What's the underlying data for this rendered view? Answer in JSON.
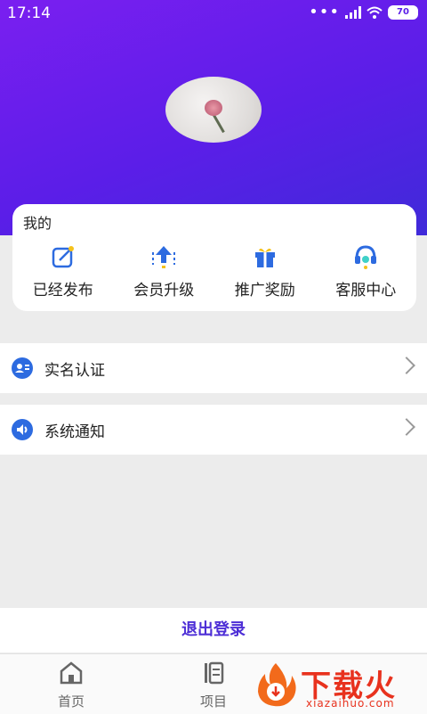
{
  "status": {
    "time": "17:14",
    "battery": "70",
    "signal": "HD"
  },
  "card": {
    "title": "我的",
    "items": [
      {
        "label": "已经发布",
        "icon": "edit-icon"
      },
      {
        "label": "会员升级",
        "icon": "upgrade-icon"
      },
      {
        "label": "推广奖励",
        "icon": "gift-icon"
      },
      {
        "label": "客服中心",
        "icon": "headset-icon"
      }
    ]
  },
  "menu": [
    {
      "label": "实名认证",
      "icon": "id-card-icon"
    },
    {
      "label": "系统通知",
      "icon": "speaker-icon"
    }
  ],
  "logout_label": "退出登录",
  "tabs": [
    {
      "label": "首页",
      "icon": "home-icon"
    },
    {
      "label": "项目",
      "icon": "project-icon"
    }
  ],
  "watermark": {
    "title": "下载火",
    "domain": "xiazaihuo.com"
  },
  "colors": {
    "accent": "#4d2ed6",
    "header_start": "#7a1ff0",
    "header_end": "#3f2ad9",
    "icon_blue": "#2d6be0"
  }
}
